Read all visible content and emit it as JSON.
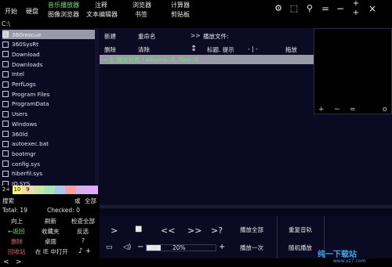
{
  "topbar": {
    "start": "开始",
    "disk": "硬盘",
    "music_player": "音乐播放器",
    "notes": "注释",
    "browser": "浏览器",
    "calculator": "计算器",
    "image_browser": "图像浏览器",
    "text_editor": "文本编辑器",
    "bookmarks": "书签",
    "clipboard": "剪贴板",
    "icons": {
      "gear": "⚙",
      "select": "⬚",
      "pin": "⚲",
      "equals": "=",
      "minus": "−",
      "plus_top": "+",
      "close": "×",
      "plus_bottom": "+"
    }
  },
  "path": "C:\\",
  "files": [
    {
      "name": "360rescue",
      "selected": true
    },
    {
      "name": "360SysRt",
      "selected": false
    },
    {
      "name": "Download",
      "selected": false
    },
    {
      "name": "Downloads",
      "selected": false
    },
    {
      "name": "Intel",
      "selected": false
    },
    {
      "name": "PerfLogs",
      "selected": false
    },
    {
      "name": "Program Files",
      "selected": false
    },
    {
      "name": "ProgramData",
      "selected": false
    },
    {
      "name": "Users",
      "selected": false
    },
    {
      "name": "Windows",
      "selected": false
    },
    {
      "name": "360ld",
      "selected": false
    },
    {
      "name": "autoexec.bat",
      "selected": false
    },
    {
      "name": "bootmgr",
      "selected": false
    },
    {
      "name": "config.sys",
      "selected": false
    },
    {
      "name": "hiberfil.sys",
      "selected": false
    },
    {
      "name": "IO.SYS",
      "selected": false
    }
  ],
  "colorstrip": {
    "label": "2+",
    "swatches": [
      {
        "color": "#f6f37a",
        "text": "10"
      },
      {
        "color": "#f3d9a8",
        "text": "9"
      },
      {
        "color": "#c8e6a8",
        "text": ""
      },
      {
        "color": "#a8e4b8",
        "text": ""
      },
      {
        "color": "#a8c8f0",
        "text": ""
      },
      {
        "color": "#f5a0a0",
        "text": ""
      },
      {
        "color": "#d8b0f0",
        "text": ""
      },
      {
        "color": "#e0a8ff",
        "text": ""
      }
    ]
  },
  "left": {
    "search": "搜索",
    "or": "或",
    "all": "全部",
    "total": "Total: 19",
    "checked": "Checked: 0",
    "up": "向上",
    "refresh": "刷新",
    "check_all": "检查全部",
    "back": "←返回",
    "favorites": "收藏夹",
    "invert": "反选",
    "delete": "删除",
    "desktop": "桌面",
    "question": "?",
    "recycle": "回收站",
    "open_ie": "在 IE 中打开",
    "music_note": "♪ +"
  },
  "mid": {
    "new": "新建",
    "rename": "重命名",
    "delete": "删除",
    "clear": "清除",
    "play_file_arrow": ">>",
    "play_file": "播放文件:",
    "updown": "↕",
    "title_hint": "标题. 提示",
    "dash": "- | -",
    "drag": "拖放",
    "playlist_row": "→  主 播放列表   |   albums: 0,  files: 0"
  },
  "right": {
    "plus": "+",
    "minus": "−",
    "equals": "=",
    "circle": "o"
  },
  "transport": {
    "play": ">",
    "stop": "■",
    "prev": "<<",
    "next": ">>",
    "random": ">?",
    "volume_icon": "▭",
    "mute_icon": "◁)",
    "vol_minus": "−",
    "vol_plus": "+",
    "volume": "20%",
    "volume_fraction": 0.2
  },
  "playpanel": {
    "play_all": "播放全部",
    "repeat": "重复音轨",
    "play_once": "播放一次",
    "random_play": "随机播放"
  },
  "status": {
    "nav": "< >",
    "nav_left": "<",
    "nav_right": ">"
  },
  "watermark": {
    "text": "纯一下载站",
    "url": "www.xz7.com"
  }
}
